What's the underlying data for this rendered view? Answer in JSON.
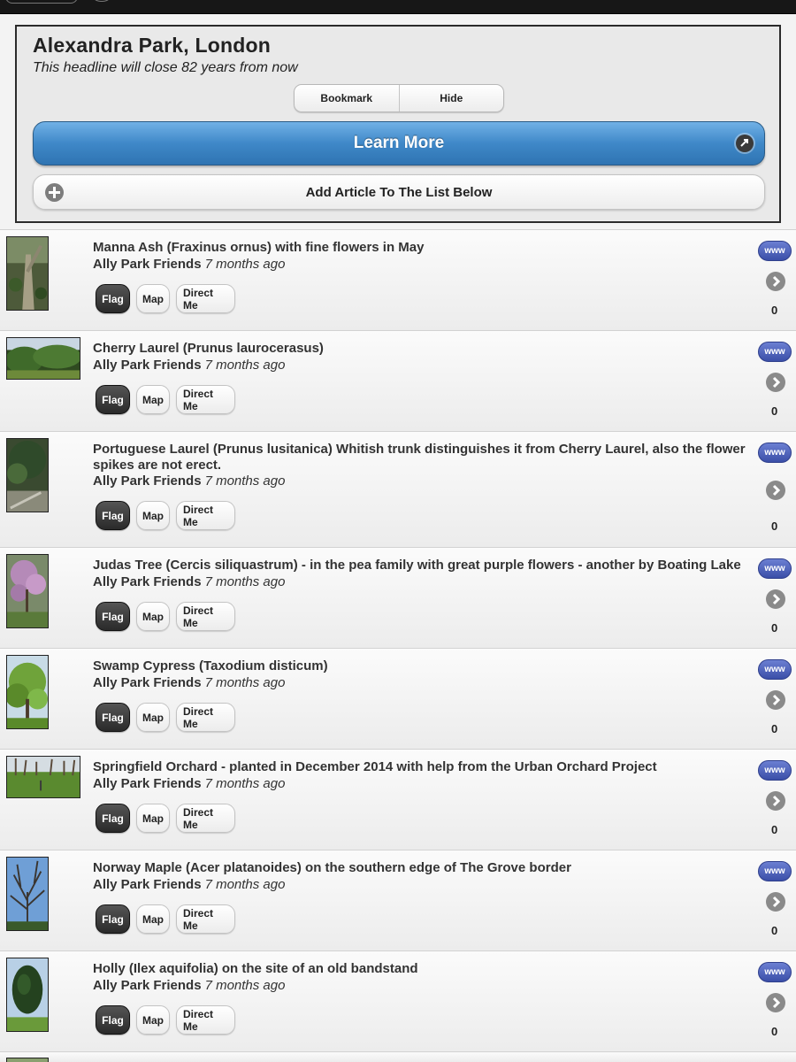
{
  "header": {
    "title": "Alexandra Park, London",
    "subtitle": "This headline will close 82 years from now",
    "bookmark_label": "Bookmark",
    "hide_label": "Hide",
    "learn_more_label": "Learn More",
    "add_article_label": "Add Article To The List Below"
  },
  "colors": {
    "accent": "#3f88c8",
    "www_badge": "#4a5fbf",
    "flag_button": "#333333"
  },
  "items": [
    {
      "title": "Manna Ash (Fraxinus ornus) with fine flowers in May",
      "author": "Ally Park Friends",
      "age": "7 months ago",
      "flag": "Flag",
      "map": "Map",
      "direct": "Direct Me",
      "www": "www",
      "count": "0",
      "thumb_icon": "tree-trunk-photo"
    },
    {
      "title": "Cherry Laurel (Prunus laurocerasus)",
      "author": "Ally Park Friends",
      "age": "7 months ago",
      "flag": "Flag",
      "map": "Map",
      "direct": "Direct Me",
      "www": "www",
      "count": "0",
      "thumb_icon": "hedge-photo"
    },
    {
      "title": "Portuguese Laurel (Prunus lusitanica) Whitish trunk distinguishes it from Cherry Laurel, also the flower spikes are not erect.",
      "author": "Ally Park Friends",
      "age": "7 months ago",
      "flag": "Flag",
      "map": "Map",
      "direct": "Direct Me",
      "www": "www",
      "count": "0",
      "thumb_icon": "laurel-photo"
    },
    {
      "title": "Judas Tree (Cercis siliquastrum) - in the pea family with great purple flowers - another by Boating Lake",
      "author": "Ally Park Friends",
      "age": "7 months ago",
      "flag": "Flag",
      "map": "Map",
      "direct": "Direct Me",
      "www": "www",
      "count": "0",
      "thumb_icon": "blossom-photo"
    },
    {
      "title": "Swamp Cypress (Taxodium disticum)",
      "author": "Ally Park Friends",
      "age": "7 months ago",
      "flag": "Flag",
      "map": "Map",
      "direct": "Direct Me",
      "www": "www",
      "count": "0",
      "thumb_icon": "green-tree-photo"
    },
    {
      "title": "Springfield Orchard - planted in December 2014 with help from the Urban Orchard Project",
      "author": "Ally Park Friends",
      "age": "7 months ago",
      "flag": "Flag",
      "map": "Map",
      "direct": "Direct Me",
      "www": "www",
      "count": "0",
      "thumb_icon": "orchard-photo"
    },
    {
      "title": "Norway Maple (Acer platanoides) on the southern edge of The Grove border",
      "author": "Ally Park Friends",
      "age": "7 months ago",
      "flag": "Flag",
      "map": "Map",
      "direct": "Direct Me",
      "www": "www",
      "count": "0",
      "thumb_icon": "bare-tree-photo"
    },
    {
      "title": "Holly (Ilex aquifolia) on the site of an old bandstand",
      "author": "Ally Park Friends",
      "age": "7 months ago",
      "flag": "Flag",
      "map": "Map",
      "direct": "Direct Me",
      "www": "www",
      "count": "0",
      "thumb_icon": "holly-photo"
    }
  ]
}
